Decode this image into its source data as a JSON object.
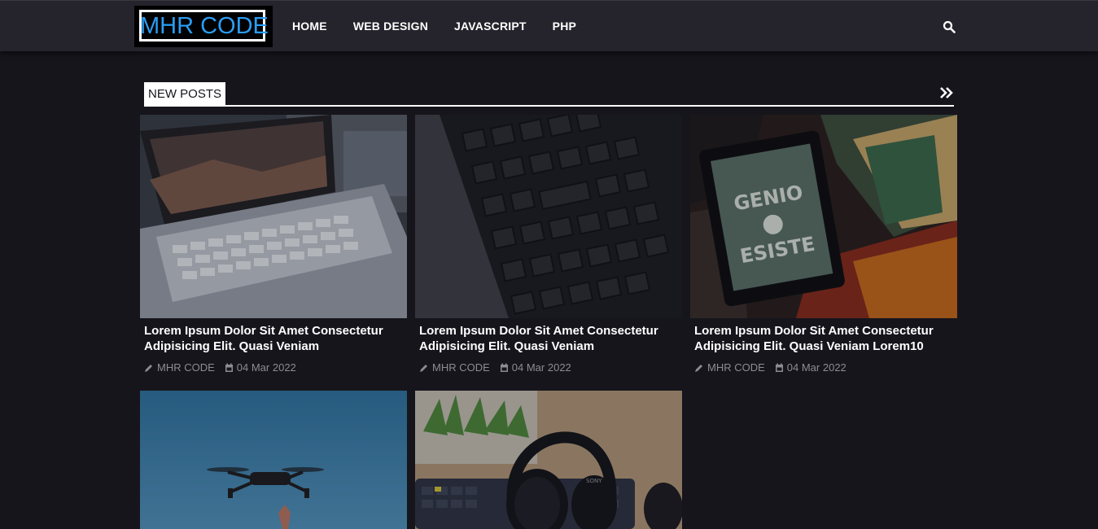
{
  "header": {
    "logo_text": "MHR CODE",
    "nav": [
      "HOME",
      "WEB DESIGN",
      "JAVASCRIPT",
      "PHP"
    ],
    "search_icon": "search-icon"
  },
  "section": {
    "title": "NEW POSTS",
    "more_icon": "double-chevron-right-icon"
  },
  "posts": [
    {
      "title": "Lorem Ipsum Dolor Sit Amet Consectetur Adipisicing Elit. Quasi Veniam",
      "author": "MHR CODE",
      "date": "04 Mar 2022",
      "image": "laptop-photo"
    },
    {
      "title": "Lorem Ipsum Dolor Sit Amet Consectetur Adipisicing Elit. Quasi Veniam",
      "author": "MHR CODE",
      "date": "04 Mar 2022",
      "image": "keyboard-photo"
    },
    {
      "title": "Lorem Ipsum Dolor Sit Amet Consectetur Adipisicing Elit. Quasi Veniam Lorem10",
      "author": "MHR CODE",
      "date": "04 Mar 2022",
      "image": "ereader-books-photo"
    },
    {
      "image": "drone-sky-photo"
    },
    {
      "image": "headphones-desk-photo"
    }
  ],
  "colors": {
    "background": "#16151c",
    "header": "#25242c",
    "logo_accent": "#2a9df4",
    "meta_text": "#8c8c93"
  }
}
